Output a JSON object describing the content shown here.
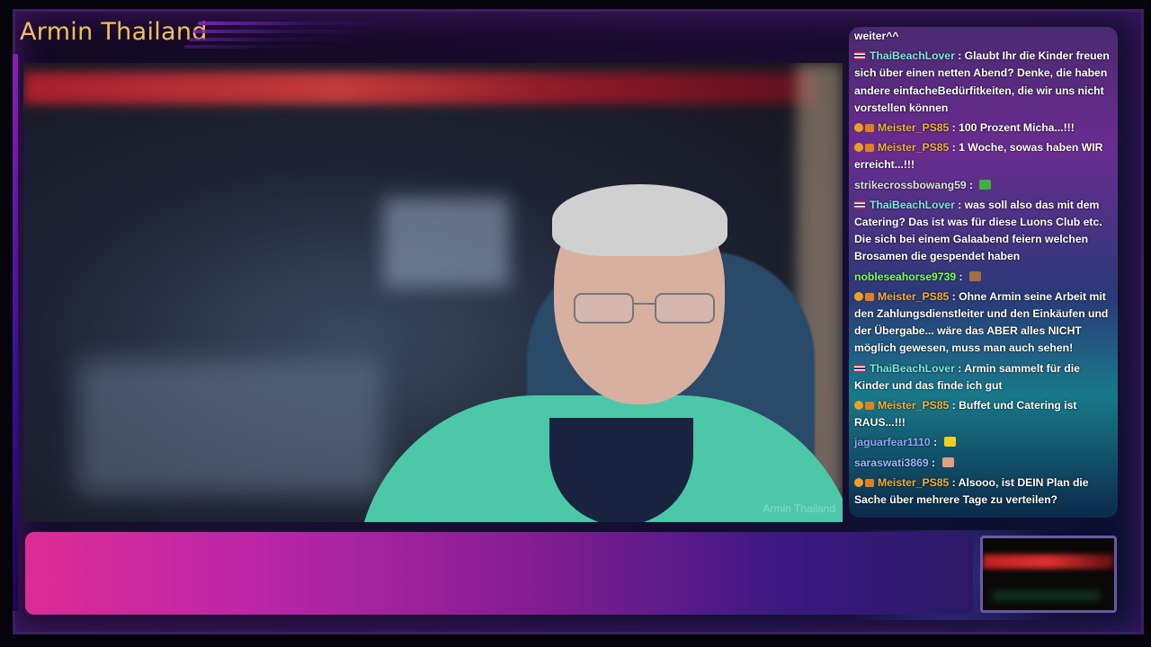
{
  "overlay": {
    "channel_title": "Armin Thailand",
    "watermark": "Armin Thailand"
  },
  "chat": {
    "messages": [
      {
        "user": "",
        "text": "weiter^^",
        "style": "plain"
      },
      {
        "user": "ThaiBeachLover",
        "text": "Glaubt Ihr die Kinder freuen sich über einen netten Abend? Denke, die haben andere einfacheBedürfitkeiten, die wir uns nicht vorstellen können",
        "style": "thai"
      },
      {
        "user": "Meister_PS85",
        "text": "100 Prozent Micha...!!!",
        "style": "meister"
      },
      {
        "user": "Meister_PS85",
        "text": "1 Woche, sowas haben WIR erreicht...!!!",
        "style": "meister"
      },
      {
        "user": "strikecrossbowang59",
        "text": "",
        "style": "strike",
        "emote": "green-box"
      },
      {
        "user": "ThaiBeachLover",
        "text": "was soll also das mit dem Catering? Das ist was für diese Luons Club etc. Die sich bei einem Galaabend feiern welchen Brosamen die gespendet haben",
        "style": "thai"
      },
      {
        "user": "nobleseahorse9739",
        "text": "",
        "style": "noble",
        "emote": "brown-figure"
      },
      {
        "user": "Meister_PS85",
        "text": "Ohne Armin seine Arbeit mit den Zahlungsdienstleiter und den Einkäufen und der Übergabe... wäre das ABER alles NICHT möglich gewesen, muss man auch sehen!",
        "style": "meister"
      },
      {
        "user": "ThaiBeachLover",
        "text": "Armin sammelt für die Kinder und das finde ich gut",
        "style": "thai"
      },
      {
        "user": "Meister_PS85",
        "text": "Buffet und Catering ist RAUS...!!!",
        "style": "meister"
      },
      {
        "user": "jaguarfear1110",
        "text": "",
        "style": "jaguar",
        "emote": "yellow-chick"
      },
      {
        "user": "saraswati3869",
        "text": "",
        "style": "saras",
        "emote": "peach-figure"
      },
      {
        "user": "Meister_PS85",
        "text": "Alsooo, ist DEIN Plan die Sache über mehrere Tage zu verteilen?",
        "style": "meister"
      }
    ]
  },
  "colors": {
    "title": "#f0c060",
    "thai_user": "#7ce8e0",
    "meister_user": "#f0b040",
    "noble_user": "#80ff60"
  },
  "icons": {
    "thai_badge": "thai-flag-icon",
    "meister_badges": "sub-badge-icon"
  }
}
